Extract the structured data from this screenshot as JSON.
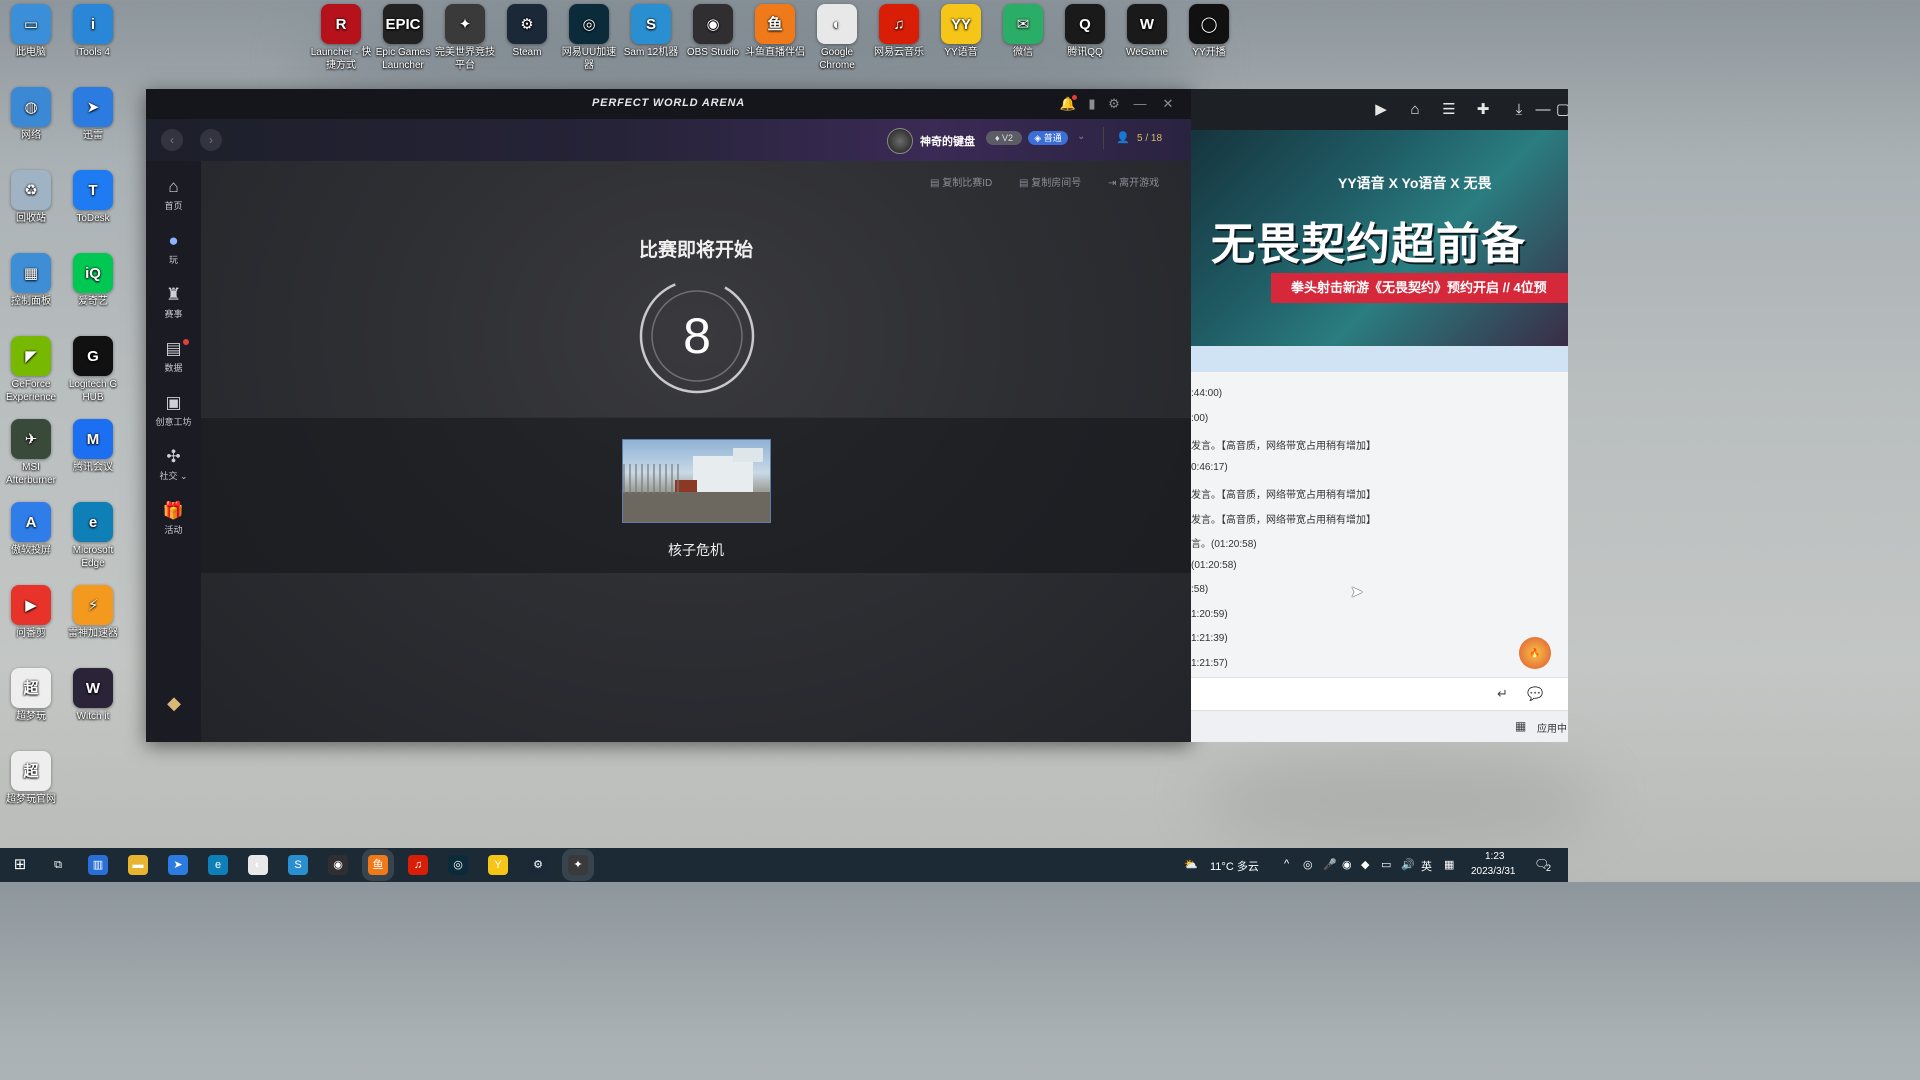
{
  "desktop": {
    "top_icons": [
      {
        "label": "Launcher - 快捷方式",
        "icon": "raka-launcher-icon",
        "color": "#b5121b",
        "glyph": "R"
      },
      {
        "label": "Epic Games Launcher",
        "icon": "epic-games-icon",
        "color": "#222222",
        "glyph": "EPIC"
      },
      {
        "label": "完美世界竞技平台",
        "icon": "perfect-world-icon",
        "color": "#3a3a3a",
        "glyph": "✦"
      },
      {
        "label": "Steam",
        "icon": "steam-icon",
        "color": "#1b2838",
        "glyph": "⚙"
      },
      {
        "label": "网易UU加速器",
        "icon": "uu-accelerator-icon",
        "color": "#0b2a3a",
        "glyph": "◎"
      },
      {
        "label": "Sam 12机器",
        "icon": "sam-icon",
        "color": "#2a8fd0",
        "glyph": "S"
      },
      {
        "label": "OBS Studio",
        "icon": "obs-icon",
        "color": "#302e31",
        "glyph": "◉"
      },
      {
        "label": "斗鱼直播伴侣",
        "icon": "douyu-icon",
        "color": "#f07a1a",
        "glyph": "鱼"
      },
      {
        "label": "Google Chrome",
        "icon": "chrome-icon",
        "color": "#e8e8e8",
        "glyph": "◐"
      },
      {
        "label": "网易云音乐",
        "icon": "netease-music-icon",
        "color": "#d81e06",
        "glyph": "♫"
      },
      {
        "label": "YY语音",
        "icon": "yy-icon",
        "color": "#f5c518",
        "glyph": "YY"
      },
      {
        "label": "微信",
        "icon": "wechat-icon",
        "color": "#2aae67",
        "glyph": "✉"
      },
      {
        "label": "腾讯QQ",
        "icon": "qq-icon",
        "color": "#1a1a1a",
        "glyph": "Q"
      },
      {
        "label": "WeGame",
        "icon": "wegame-icon",
        "color": "#1a1a1a",
        "glyph": "W"
      },
      {
        "label": "YY开播",
        "icon": "yy-live-icon",
        "color": "#111111",
        "glyph": "◯"
      }
    ],
    "left_icons": [
      {
        "label": "此电脑",
        "icon": "this-pc-icon",
        "color": "#3a8fd8",
        "glyph": "▭"
      },
      {
        "label": "iTools 4",
        "icon": "itools-icon",
        "color": "#2a86d6",
        "glyph": "i"
      },
      {
        "label": "网络",
        "icon": "network-icon",
        "color": "#3b88d4",
        "glyph": "◍"
      },
      {
        "label": "迅雷",
        "icon": "xunlei-icon",
        "color": "#2b7be0",
        "glyph": "➤"
      },
      {
        "label": "回收站",
        "icon": "recycle-bin-icon",
        "color": "#9fb3c4",
        "glyph": "♻"
      },
      {
        "label": "ToDesk",
        "icon": "todesk-icon",
        "color": "#1f7bf2",
        "glyph": "T"
      },
      {
        "label": "控制面板",
        "icon": "control-panel-icon",
        "color": "#3e8ed6",
        "glyph": "▦"
      },
      {
        "label": "爱奇艺",
        "icon": "iqiyi-icon",
        "color": "#00c853",
        "glyph": "iQ"
      },
      {
        "label": "GeForce Experience",
        "icon": "geforce-icon",
        "color": "#76b900",
        "glyph": "◤"
      },
      {
        "label": "Logitech G HUB",
        "icon": "logitech-icon",
        "color": "#111111",
        "glyph": "G"
      },
      {
        "label": "MSI Afterburner",
        "icon": "msi-afterburner-icon",
        "color": "#3a4a3a",
        "glyph": "✈"
      },
      {
        "label": "腾讯会议",
        "icon": "tencent-meeting-icon",
        "color": "#1d6ff2",
        "glyph": "M"
      },
      {
        "label": "傲软投屏",
        "icon": "apowermirror-icon",
        "color": "#2f7de8",
        "glyph": "A"
      },
      {
        "label": "Microsoft Edge",
        "icon": "edge-icon",
        "color": "#0f7fb8",
        "glyph": "e"
      },
      {
        "label": "问番剪",
        "icon": "video-editor-icon",
        "color": "#e8332a",
        "glyph": "▶"
      },
      {
        "label": "雷神加速器",
        "icon": "leishen-icon",
        "color": "#f39a1e",
        "glyph": "⚡"
      },
      {
        "label": "超梦玩",
        "icon": "chaomeng-icon",
        "color": "#eeeeee",
        "glyph": "超"
      },
      {
        "label": "Witch it",
        "icon": "witch-it-icon",
        "color": "#2b2338",
        "glyph": "W"
      },
      {
        "label": "超梦玩官网",
        "icon": "chaomeng-site-icon",
        "color": "#eeeeee",
        "glyph": "超"
      }
    ]
  },
  "app": {
    "title": "PERFECT WORLD ARENA",
    "user_name": "神奇的键盘",
    "level_badge": "V2",
    "rank_badge": "普通",
    "party_count": "5 / 18",
    "sidebar": [
      {
        "label": "首页",
        "icon": "home-icon",
        "glyph": "⌂"
      },
      {
        "label": "玩",
        "icon": "play-icon",
        "glyph": "●"
      },
      {
        "label": "赛事",
        "icon": "trophy-icon",
        "glyph": "♜"
      },
      {
        "label": "数据",
        "icon": "data-icon",
        "glyph": "▤"
      },
      {
        "label": "创意工坊",
        "icon": "workshop-icon",
        "glyph": "▣"
      },
      {
        "label": "社交 ⌄",
        "icon": "social-icon",
        "glyph": "✣"
      },
      {
        "label": "活动",
        "icon": "gift-icon",
        "glyph": "🎁"
      }
    ],
    "toolbar": {
      "copy_match_id": "复制比赛ID",
      "copy_room_id": "复制房间号",
      "leave_game": "离开游戏"
    },
    "match": {
      "heading": "比赛即将开始",
      "countdown": "8",
      "map_name": "核子危机"
    }
  },
  "side_window": {
    "banner_tags": "YY语音 X Yo语音 X 无畏",
    "banner_title": "无畏契约超前备",
    "banner_subtitle": "拳头射击新游《无畏契约》预约开启 // 4位预",
    "log_lines": [
      ":44:00)",
      ":00)",
      "发言。【高音质，网络带宽占用稍有增加】",
      "0:46:17)",
      "发言。【高音质，网络带宽占用稍有增加】",
      "发言。【高音质，网络带宽占用稍有增加】",
      "言。(01:20:58)",
      " (01:20:58)",
      ":58)",
      "1:20:59)",
      "1:21:39)",
      "1:21:57)"
    ],
    "app_center": "应用中"
  },
  "taskbar": {
    "weather": "11°C 多云",
    "ime": "英",
    "time": "1:23",
    "date": "2023/3/31",
    "notifications": "2",
    "pinned": [
      {
        "icon": "task-view-icon",
        "color": "#1c2a35",
        "glyph": "⧉"
      },
      {
        "icon": "store-icon",
        "color": "#2a6fd8",
        "glyph": "▥"
      },
      {
        "icon": "file-explorer-icon",
        "color": "#e8b530",
        "glyph": "▬"
      },
      {
        "icon": "xunlei-task-icon",
        "color": "#2b7be0",
        "glyph": "➤"
      },
      {
        "icon": "edge-task-icon",
        "color": "#0f7fb8",
        "glyph": "e"
      },
      {
        "icon": "chrome-task-icon",
        "color": "#e8e8e8",
        "glyph": "◐"
      },
      {
        "icon": "sam-task-icon",
        "color": "#2a8fd0",
        "glyph": "S"
      },
      {
        "icon": "obs-task-icon",
        "color": "#302e31",
        "glyph": "◉"
      },
      {
        "icon": "douyu-task-icon",
        "color": "#f07a1a",
        "glyph": "鱼"
      },
      {
        "icon": "netease-task-icon",
        "color": "#d81e06",
        "glyph": "♫"
      },
      {
        "icon": "uu-task-icon",
        "color": "#0b2a3a",
        "glyph": "◎"
      },
      {
        "icon": "yy-task-icon",
        "color": "#f5c518",
        "glyph": "Y"
      },
      {
        "icon": "steam-task-icon",
        "color": "#1b2838",
        "glyph": "⚙"
      },
      {
        "icon": "perfect-world-task-icon",
        "color": "#3a3a3a",
        "glyph": "✦"
      }
    ]
  }
}
